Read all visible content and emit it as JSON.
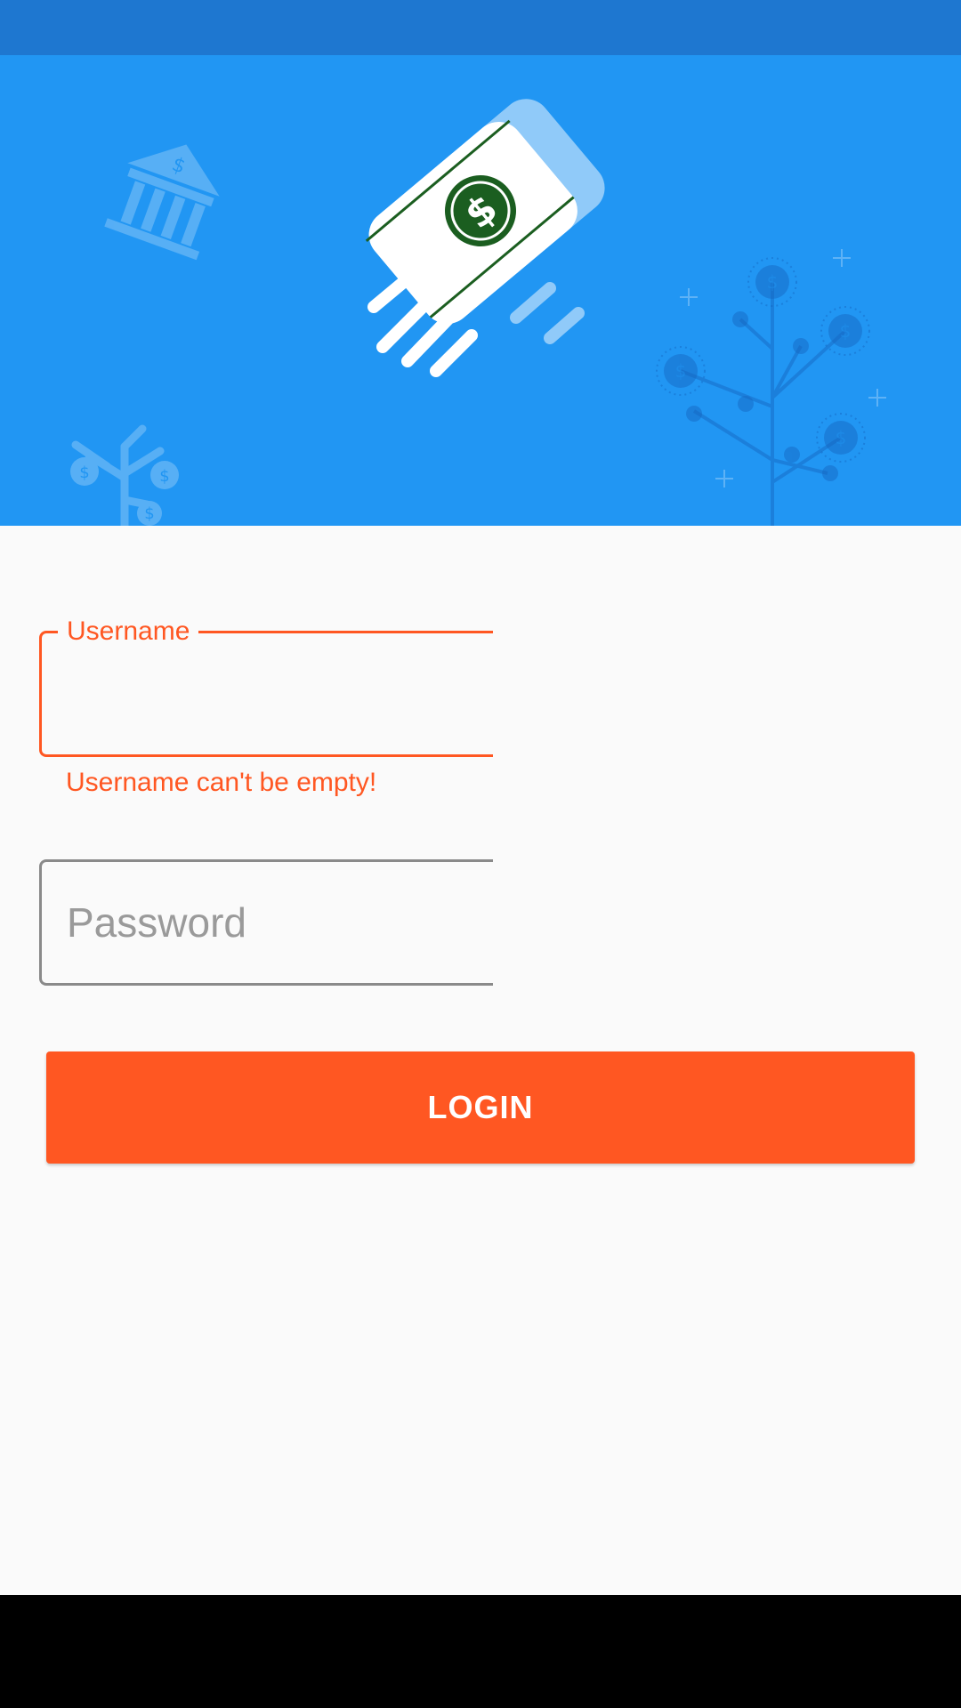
{
  "status_bar": {},
  "header": {
    "logo_icon": "flying-dollar-bill-icon",
    "decor_icons": [
      "bank-icon",
      "money-tree-icon",
      "money-plant-icon"
    ],
    "bill_symbol": "$"
  },
  "login_form": {
    "username": {
      "label": "Username",
      "value": "",
      "error": "Username can't be empty!"
    },
    "password": {
      "placeholder": "Password",
      "value": ""
    },
    "login_button_label": "LOGIN"
  },
  "colors": {
    "status_bar": "#1e77d0",
    "header": "#2196f3",
    "accent": "#ff5722",
    "background": "#fafafa",
    "nav_bar": "#000000"
  }
}
